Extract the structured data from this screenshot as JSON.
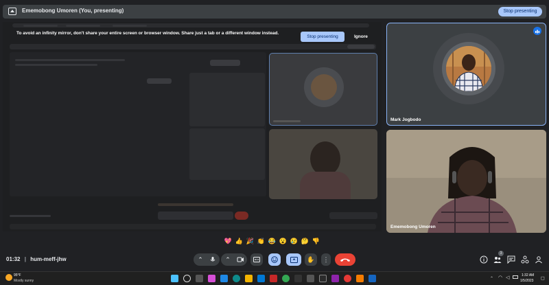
{
  "present_bar": {
    "title": "Ememobong Umoren (You, presenting)",
    "stop_label": "Stop presenting"
  },
  "share_warning": {
    "message": "To avoid an infinity mirror, don't share your entire screen or browser window. Share just a tab or a different window instead.",
    "stop_label": "Stop presenting",
    "ignore_label": "Ignore"
  },
  "participants": [
    {
      "name": "Mark Jogbodo"
    },
    {
      "name": "Ememobong Umoren"
    }
  ],
  "reactions": [
    "💖",
    "👍",
    "🎉",
    "👏",
    "😂",
    "😮",
    "😢",
    "🤔",
    "👎"
  ],
  "call": {
    "time": "01:32",
    "meeting_code": "hum-meff-jhw",
    "people_count": "3"
  },
  "taskbar": {
    "weather_temp": "95°F",
    "weather_desc": "Mostly sunny",
    "clock_time": "1:32 AM",
    "clock_date": "1/5/2023"
  },
  "colors": {
    "accent": "#a8c7fa",
    "end_call": "#ea4335",
    "background": "#202124",
    "highlight_border": "#8ab4f8"
  }
}
